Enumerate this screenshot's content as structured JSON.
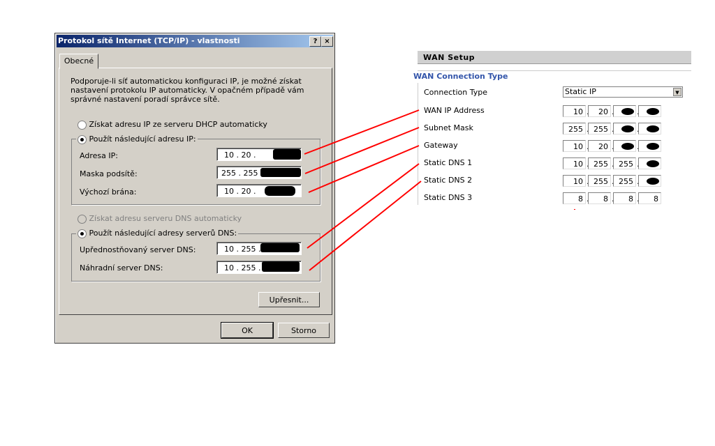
{
  "dialog": {
    "title": "Protokol sítě Internet (TCP/IP) - vlastnosti",
    "help_button": "?",
    "close_button": "×",
    "tab": "Obecné",
    "intro": "Podporuje-li síť automatickou konfiguraci IP, je možné získat nastavení protokolu IP automaticky. V opačném případě vám správné nastavení poradí správce sítě.",
    "radio_dhcp": "Získat adresu IP ze serveru DHCP automaticky",
    "radio_static": "Použít následující adresu IP:",
    "ip_label": "Adresa IP:",
    "ip_value": "10 . 20 .",
    "mask_label": "Maska podsítě:",
    "mask_value": "255 . 255 .",
    "gateway_label": "Výchozí brána:",
    "gateway_value": "10 . 20 .",
    "radio_dns_auto": "Získat adresu serveru DNS automaticky",
    "radio_dns_static": "Použít následující adresy serverů DNS:",
    "dns1_label": "Upřednostňovaný server DNS:",
    "dns1_value": "10 . 255 .",
    "dns2_label": "Náhradní server DNS:",
    "dns2_value": "10 . 255 .",
    "advanced_button": "Upřesnit...",
    "ok_button": "OK",
    "cancel_button": "Storno"
  },
  "wan": {
    "header": "WAN Setup",
    "section": "WAN Connection Type",
    "accent": "#3355aa",
    "rows": [
      {
        "label": "Connection Type",
        "select": "Static IP"
      },
      {
        "label": "WAN IP Address",
        "octets": [
          "10",
          "20",
          "",
          ""
        ]
      },
      {
        "label": "Subnet Mask",
        "octets": [
          "255",
          "255",
          "",
          ""
        ]
      },
      {
        "label": "Gateway",
        "octets": [
          "10",
          "20",
          "",
          ""
        ]
      },
      {
        "label": "Static DNS 1",
        "octets": [
          "10",
          "255",
          "255",
          ""
        ]
      },
      {
        "label": "Static DNS 2",
        "octets": [
          "10",
          "255",
          "255",
          ""
        ]
      },
      {
        "label": "Static DNS 3",
        "octets": [
          "8",
          "8",
          "8",
          "8"
        ]
      }
    ]
  },
  "annotation_color": "#ff0000"
}
